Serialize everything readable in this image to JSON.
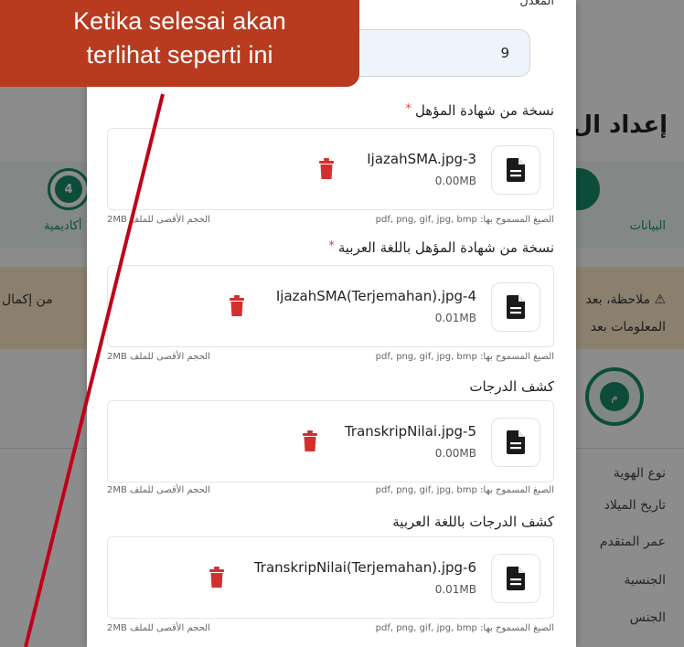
{
  "callout": {
    "line1": "Ketika selesai akan",
    "line2": "terlihat seperti ini"
  },
  "background": {
    "header_title": "إعداد ال",
    "step4_number": "4",
    "step4_label": "أكاديمية",
    "step1_label": "البيانات",
    "notice_line1": "⚠ ملاحظة، بعد",
    "notice_line2": "المعلومات بعد",
    "notice_left": "من إكمال",
    "profile_initial": "م",
    "info_labels": [
      "نوع الهوية",
      "تاريخ الميلاد",
      "عمر المتقدم",
      "الجنسية",
      "الجنس"
    ]
  },
  "modal": {
    "gpa_label": "المعدل",
    "gpa_value": "9",
    "allowed_formats": "الصيغ المسموح بها: pdf, png, gif, jpg, bmp",
    "max_size": "الحجم الأقصى للملف 2MB",
    "uploads": [
      {
        "label": "نسخة من شهادة المؤهل",
        "required": true,
        "file_name": "IjazahSMA.jpg-3",
        "file_size": "0.00MB"
      },
      {
        "label": "نسخة من شهادة المؤهل باللغة العربية",
        "required": true,
        "file_name": "IjazahSMA(Terjemahan).jpg-4",
        "file_size": "0.01MB"
      },
      {
        "label": "كشف الدرجات",
        "required": false,
        "file_name": "TranskripNilai.jpg-5",
        "file_size": "0.00MB"
      },
      {
        "label": "كشف الدرجات باللغة العربية",
        "required": false,
        "file_name": "TranskripNilai(Terjemahan).jpg-6",
        "file_size": "0.01MB"
      }
    ]
  },
  "colors": {
    "callout": "#b83b1f",
    "pointer_line": "#c0001a",
    "brand_green": "#1b8a6b",
    "trash_red": "#d32f2f",
    "required_star": "#e53935"
  },
  "icons": {
    "file": "document-icon",
    "delete": "trash-icon"
  }
}
